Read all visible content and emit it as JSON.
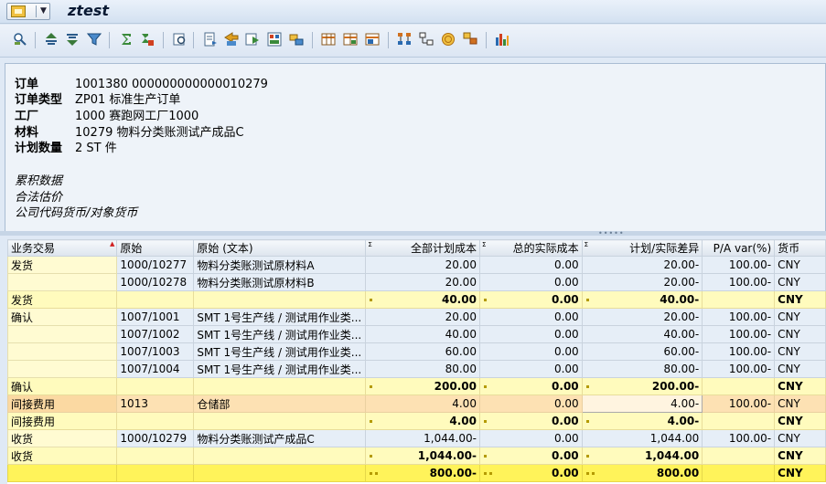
{
  "title": "ztest",
  "header": {
    "fields": [
      {
        "label": "订单",
        "value": "1001380 000000000000010279"
      },
      {
        "label": "订单类型",
        "value": "ZP01 标准生产订单"
      },
      {
        "label": "工厂",
        "value": "1000 赛跑网工厂1000"
      },
      {
        "label": "材料",
        "value": "10279 物料分类账测试产成品C"
      },
      {
        "label": "计划数量",
        "value": "2 ST 件"
      }
    ],
    "notes": [
      "累积数据",
      "合法估价",
      "公司代码货币/对象货币"
    ]
  },
  "toolbar_icons": [
    "details-icon",
    "sort-ascending-icon",
    "sort-descending-icon",
    "filter-icon",
    "sum-icon",
    "subtotal-icon",
    "print-preview-icon",
    "export-icon",
    "send-icon",
    "download-icon",
    "abc-icon",
    "choose-layout-icon",
    "change-layout-icon",
    "save-layout-icon",
    "hierarchy-icon",
    "network-icon",
    "currency-icon",
    "structure-icon",
    "graphic-icon"
  ],
  "grid": {
    "columns": [
      "业务交易",
      "原始",
      "原始 (文本)",
      "全部计划成本",
      "总的实际成本",
      "计划/实际差异",
      "P/A var(%)",
      "货币"
    ],
    "rows": [
      {
        "type": "data",
        "grp": "发货",
        "orig": "1000/10277",
        "text": "物料分类账测试原材料A",
        "plan": "20.00",
        "actual": "0.00",
        "diff": "20.00-",
        "pct": "100.00-",
        "cur": "CNY"
      },
      {
        "type": "data",
        "grp": "",
        "orig": "1000/10278",
        "text": "物料分类账测试原材料B",
        "plan": "20.00",
        "actual": "0.00",
        "diff": "20.00-",
        "pct": "100.00-",
        "cur": "CNY"
      },
      {
        "type": "sub",
        "grp": "发货",
        "orig": "",
        "text": "",
        "plan": "40.00",
        "actual": "0.00",
        "diff": "40.00-",
        "pct": "",
        "cur": "CNY"
      },
      {
        "type": "data",
        "grp": "确认",
        "orig": "1007/1001",
        "text": "SMT 1号生产线 / 测试用作业类...",
        "plan": "20.00",
        "actual": "0.00",
        "diff": "20.00-",
        "pct": "100.00-",
        "cur": "CNY"
      },
      {
        "type": "data",
        "grp": "",
        "orig": "1007/1002",
        "text": "SMT 1号生产线 / 测试用作业类...",
        "plan": "40.00",
        "actual": "0.00",
        "diff": "40.00-",
        "pct": "100.00-",
        "cur": "CNY"
      },
      {
        "type": "data",
        "grp": "",
        "orig": "1007/1003",
        "text": "SMT 1号生产线 / 测试用作业类...",
        "plan": "60.00",
        "actual": "0.00",
        "diff": "60.00-",
        "pct": "100.00-",
        "cur": "CNY"
      },
      {
        "type": "data",
        "grp": "",
        "orig": "1007/1004",
        "text": "SMT 1号生产线 / 测试用作业类...",
        "plan": "80.00",
        "actual": "0.00",
        "diff": "80.00-",
        "pct": "100.00-",
        "cur": "CNY"
      },
      {
        "type": "sub",
        "grp": "确认",
        "orig": "",
        "text": "",
        "plan": "200.00",
        "actual": "0.00",
        "diff": "200.00-",
        "pct": "",
        "cur": "CNY"
      },
      {
        "type": "sel",
        "grp": "间接费用",
        "orig": "1013",
        "text": "仓储部",
        "plan": "4.00",
        "actual": "0.00",
        "diff": "4.00-",
        "pct": "100.00-",
        "cur": "CNY"
      },
      {
        "type": "sub",
        "grp": "间接费用",
        "orig": "",
        "text": "",
        "plan": "4.00",
        "actual": "0.00",
        "diff": "4.00-",
        "pct": "",
        "cur": "CNY"
      },
      {
        "type": "data",
        "grp": "收货",
        "orig": "1000/10279",
        "text": "物料分类账测试产成品C",
        "plan": "1,044.00-",
        "actual": "0.00",
        "diff": "1,044.00",
        "pct": "100.00-",
        "cur": "CNY"
      },
      {
        "type": "sub",
        "grp": "收货",
        "orig": "",
        "text": "",
        "plan": "1,044.00-",
        "actual": "0.00",
        "diff": "1,044.00",
        "pct": "",
        "cur": "CNY"
      },
      {
        "type": "total",
        "grp": "",
        "orig": "",
        "text": "",
        "plan": "800.00-",
        "actual": "0.00",
        "diff": "800.00",
        "pct": "",
        "cur": "CNY"
      }
    ]
  },
  "colors": {
    "subtotal": "#fffbbd",
    "total": "#fff35a",
    "selected": "#fde1b3",
    "group": "#fffbd2"
  }
}
